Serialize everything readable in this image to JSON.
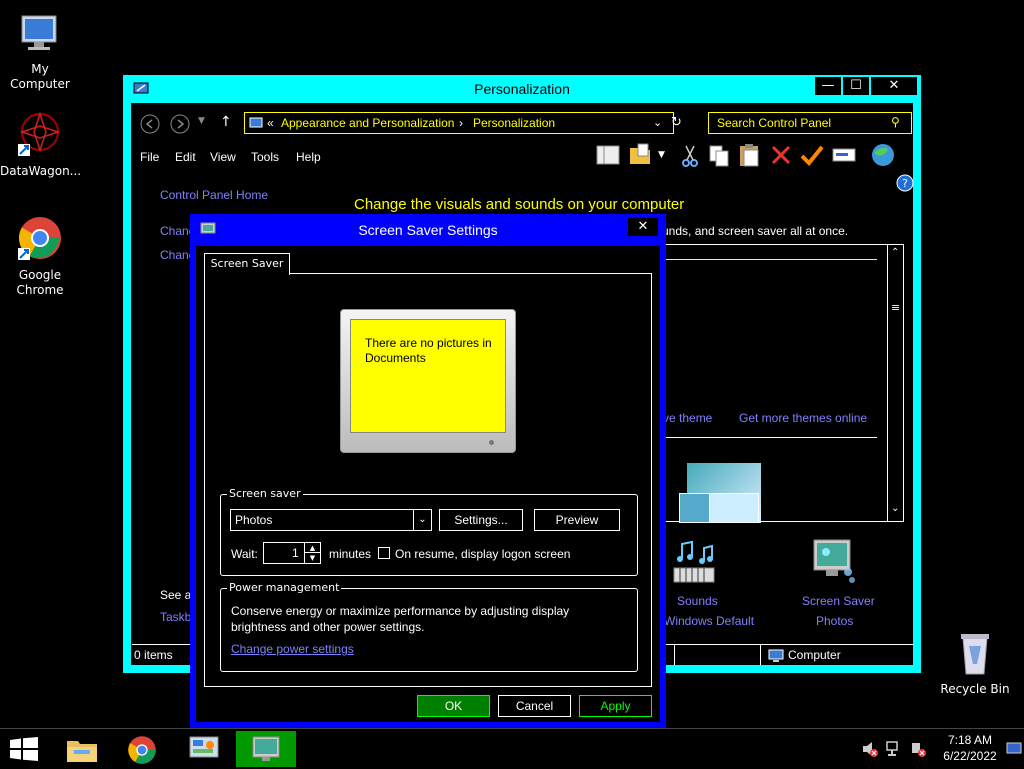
{
  "desktop": {
    "icons": [
      {
        "label": "My Computer"
      },
      {
        "label": "DataWagon..."
      },
      {
        "label": "Google Chrome"
      },
      {
        "label": "Recycle Bin"
      }
    ]
  },
  "cp_window": {
    "title": "Personalization",
    "breadcrumb_prefix": "«",
    "breadcrumb_1": "Appearance and Personalization",
    "breadcrumb_sep": "›",
    "breadcrumb_2": "Personalization",
    "search_placeholder": "Search Control Panel",
    "menu": [
      "File",
      "Edit",
      "View",
      "Tools",
      "Help"
    ],
    "sidebar_home": "Control Panel Home",
    "sidebar_change1": "Chang",
    "sidebar_change2": "Chang",
    "heading": "Change the visuals and sounds on your computer",
    "subtext": "unds, and screen saver all at once.",
    "save_theme": "ve theme",
    "get_more_themes": "Get more themes online",
    "see_also": "See al",
    "taskbar_link": "Taskb",
    "sounds_label": "Sounds",
    "sounds_value": "Windows Default",
    "screensaver_label": "Screen Saver",
    "screensaver_value": "Photos",
    "status_items": "0 items",
    "status_computer": "Computer"
  },
  "ss_dialog": {
    "title": "Screen Saver Settings",
    "tab": "Screen Saver",
    "preview_text": "There are no pictures in Documents",
    "group_screensaver": "Screen saver",
    "selected_saver": "Photos",
    "settings_btn": "Settings...",
    "preview_btn": "Preview",
    "wait_label": "Wait:",
    "wait_value": "1",
    "minutes_label": "minutes",
    "resume_label": "On resume, display logon screen",
    "resume_checked": false,
    "group_power": "Power management",
    "power_text": "Conserve energy or maximize performance by adjusting display brightness and other power settings.",
    "power_link": "Change power settings",
    "ok": "OK",
    "cancel": "Cancel",
    "apply": "Apply"
  },
  "taskbar": {
    "time": "7:18 AM",
    "date": "6/22/2022"
  },
  "colors": {
    "window_frame": "#00ffff",
    "dialog_frame": "#0000ff",
    "highlight": "#ffff00",
    "link": "#8080ff",
    "ok_green": "#00ff00"
  }
}
